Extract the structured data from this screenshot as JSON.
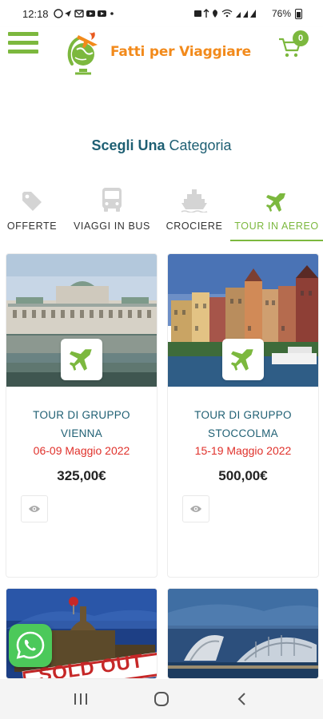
{
  "status_bar": {
    "time": "12:18",
    "battery": "76%"
  },
  "header": {
    "brand": "Fatti per Viaggiare",
    "cart_count": "0",
    "accent_color": "#7cb83e",
    "brand_color": "#f28a1b"
  },
  "section": {
    "title_bold": "Scegli Una",
    "title_light": " Categoria"
  },
  "categories": [
    {
      "label": "OFFERTE",
      "icon": "tag-icon",
      "active": false
    },
    {
      "label": "VIAGGI IN BUS",
      "icon": "bus-icon",
      "active": false
    },
    {
      "label": "CROCIERE",
      "icon": "ship-icon",
      "active": false
    },
    {
      "label": "TOUR IN AEREO",
      "icon": "plane-icon",
      "active": true
    }
  ],
  "tours": [
    {
      "title_line1": "TOUR DI GRUPPO",
      "title_line2": "VIENNA",
      "dates": "06-09 Maggio 2022",
      "price": "325,00€"
    },
    {
      "title_line1": "TOUR DI GRUPPO",
      "title_line2": "STOCCOLMA",
      "dates": "15-19 Maggio 2022",
      "price": "500,00€"
    }
  ],
  "partial_cards": [
    {
      "overlay_text": "SOLD OUT",
      "image": "budapest-parliament-sold-out"
    },
    {
      "image": "valencia-city-of-arts"
    }
  ],
  "colors": {
    "title_teal": "#1e5f73",
    "date_red": "#e0312b",
    "whatsapp_green": "#4cc95a"
  }
}
